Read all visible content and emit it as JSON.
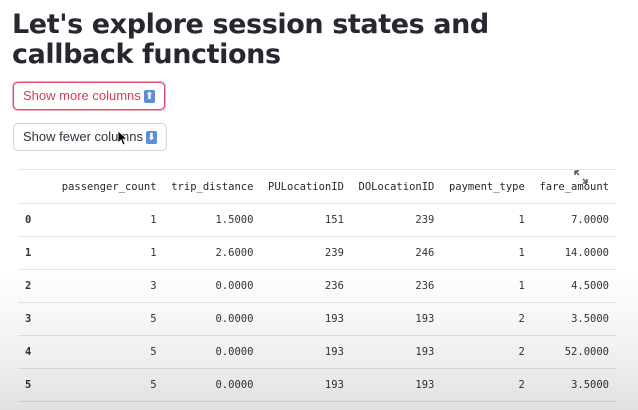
{
  "page": {
    "title": "Let's explore session states and callback functions"
  },
  "buttons": {
    "more": {
      "label": "Show more columns",
      "icon": "up-arrow-emoji-icon"
    },
    "fewer": {
      "label": "Show fewer columns",
      "icon": "down-arrow-emoji-icon"
    }
  },
  "table": {
    "columns": [
      "",
      "passenger_count",
      "trip_distance",
      "PULocationID",
      "DOLocationID",
      "payment_type",
      "fare_amount"
    ],
    "rows": [
      [
        "0",
        "1",
        "1.5000",
        "151",
        "239",
        "1",
        "7.0000"
      ],
      [
        "1",
        "1",
        "2.6000",
        "239",
        "246",
        "1",
        "14.0000"
      ],
      [
        "2",
        "3",
        "0.0000",
        "236",
        "236",
        "1",
        "4.5000"
      ],
      [
        "3",
        "5",
        "0.0000",
        "193",
        "193",
        "2",
        "3.5000"
      ],
      [
        "4",
        "5",
        "0.0000",
        "193",
        "193",
        "2",
        "52.0000"
      ],
      [
        "5",
        "5",
        "0.0000",
        "193",
        "193",
        "2",
        "3.5000"
      ]
    ]
  },
  "colors": {
    "accent": "#e14b6c",
    "emoji_blue": "#5a8fd8",
    "text": "#31333f"
  }
}
